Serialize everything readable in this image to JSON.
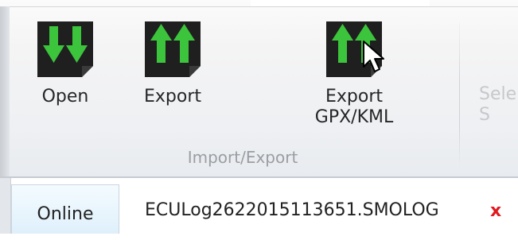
{
  "ribbon": {
    "group_label": "Import/Export",
    "buttons": [
      {
        "label": "Open",
        "icon": "arrows-down-icon"
      },
      {
        "label": "Export",
        "icon": "arrows-up-icon"
      },
      {
        "label_line1": "Export",
        "label_line2": "GPX/KML",
        "icon": "arrows-up-icon"
      }
    ],
    "cut_off_button_label": "Sele\nS",
    "colors": {
      "icon_bg": "#1f1f1f",
      "arrow_green": "#3cc43c",
      "close_red": "#e0191f"
    }
  },
  "tabs": [
    {
      "label": "Online",
      "active": true
    },
    {
      "label": "ECULog2622015113651.SMOLOG",
      "active": false,
      "close_label": "x"
    }
  ]
}
